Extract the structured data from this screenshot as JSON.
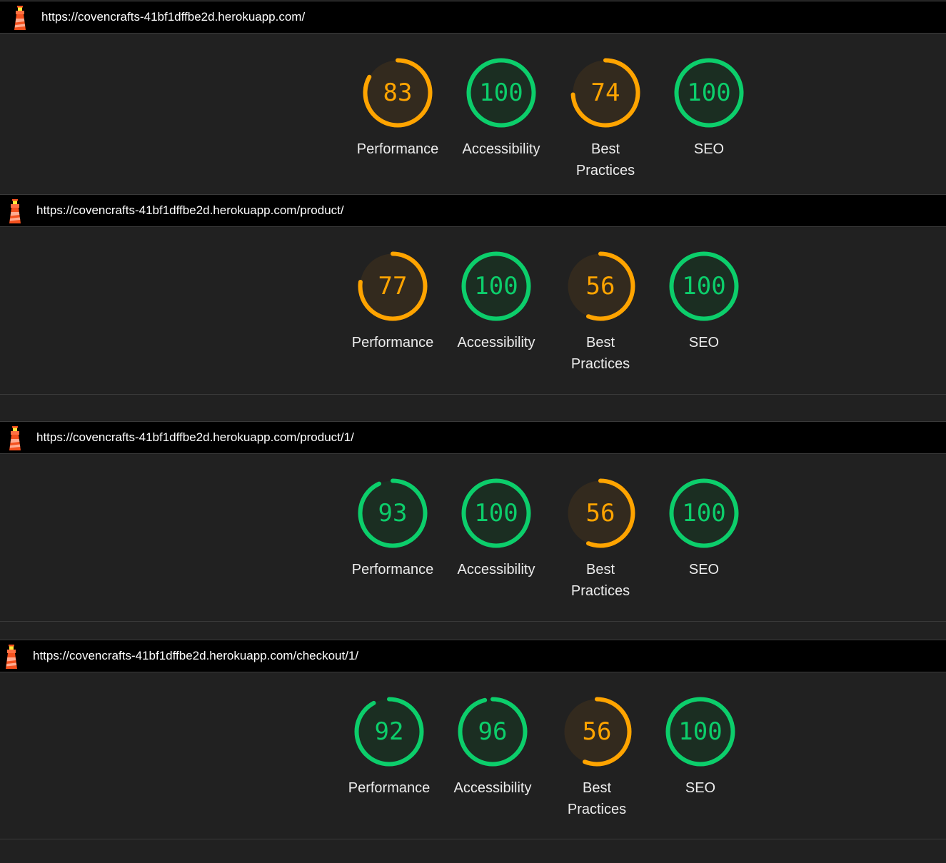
{
  "colors": {
    "pass": "#0cce6b",
    "average": "#ffa400",
    "fail": "#ff4e42"
  },
  "icon": "lighthouse-icon",
  "reports": [
    {
      "url": "https://covencrafts-41bf1dffbe2d.herokuapp.com/",
      "gauges": [
        {
          "score": "83",
          "value": 83,
          "label": "Performance"
        },
        {
          "score": "100",
          "value": 100,
          "label": "Accessibility"
        },
        {
          "score": "74",
          "value": 74,
          "label": "Best\nPractices"
        },
        {
          "score": "100",
          "value": 100,
          "label": "SEO"
        }
      ]
    },
    {
      "url": "https://covencrafts-41bf1dffbe2d.herokuapp.com/product/",
      "gauges": [
        {
          "score": "77",
          "value": 77,
          "label": "Performance"
        },
        {
          "score": "100",
          "value": 100,
          "label": "Accessibility"
        },
        {
          "score": "56",
          "value": 56,
          "label": "Best\nPractices"
        },
        {
          "score": "100",
          "value": 100,
          "label": "SEO"
        }
      ]
    },
    {
      "url": "https://covencrafts-41bf1dffbe2d.herokuapp.com/product/1/",
      "gauges": [
        {
          "score": "93",
          "value": 93,
          "label": "Performance"
        },
        {
          "score": "100",
          "value": 100,
          "label": "Accessibility"
        },
        {
          "score": "56",
          "value": 56,
          "label": "Best\nPractices"
        },
        {
          "score": "100",
          "value": 100,
          "label": "SEO"
        }
      ]
    },
    {
      "url": "https://covencrafts-41bf1dffbe2d.herokuapp.com/checkout/1/",
      "gauges": [
        {
          "score": "92",
          "value": 92,
          "label": "Performance"
        },
        {
          "score": "96",
          "value": 96,
          "label": "Accessibility"
        },
        {
          "score": "56",
          "value": 56,
          "label": "Best\nPractices"
        },
        {
          "score": "100",
          "value": 100,
          "label": "SEO"
        }
      ]
    }
  ]
}
